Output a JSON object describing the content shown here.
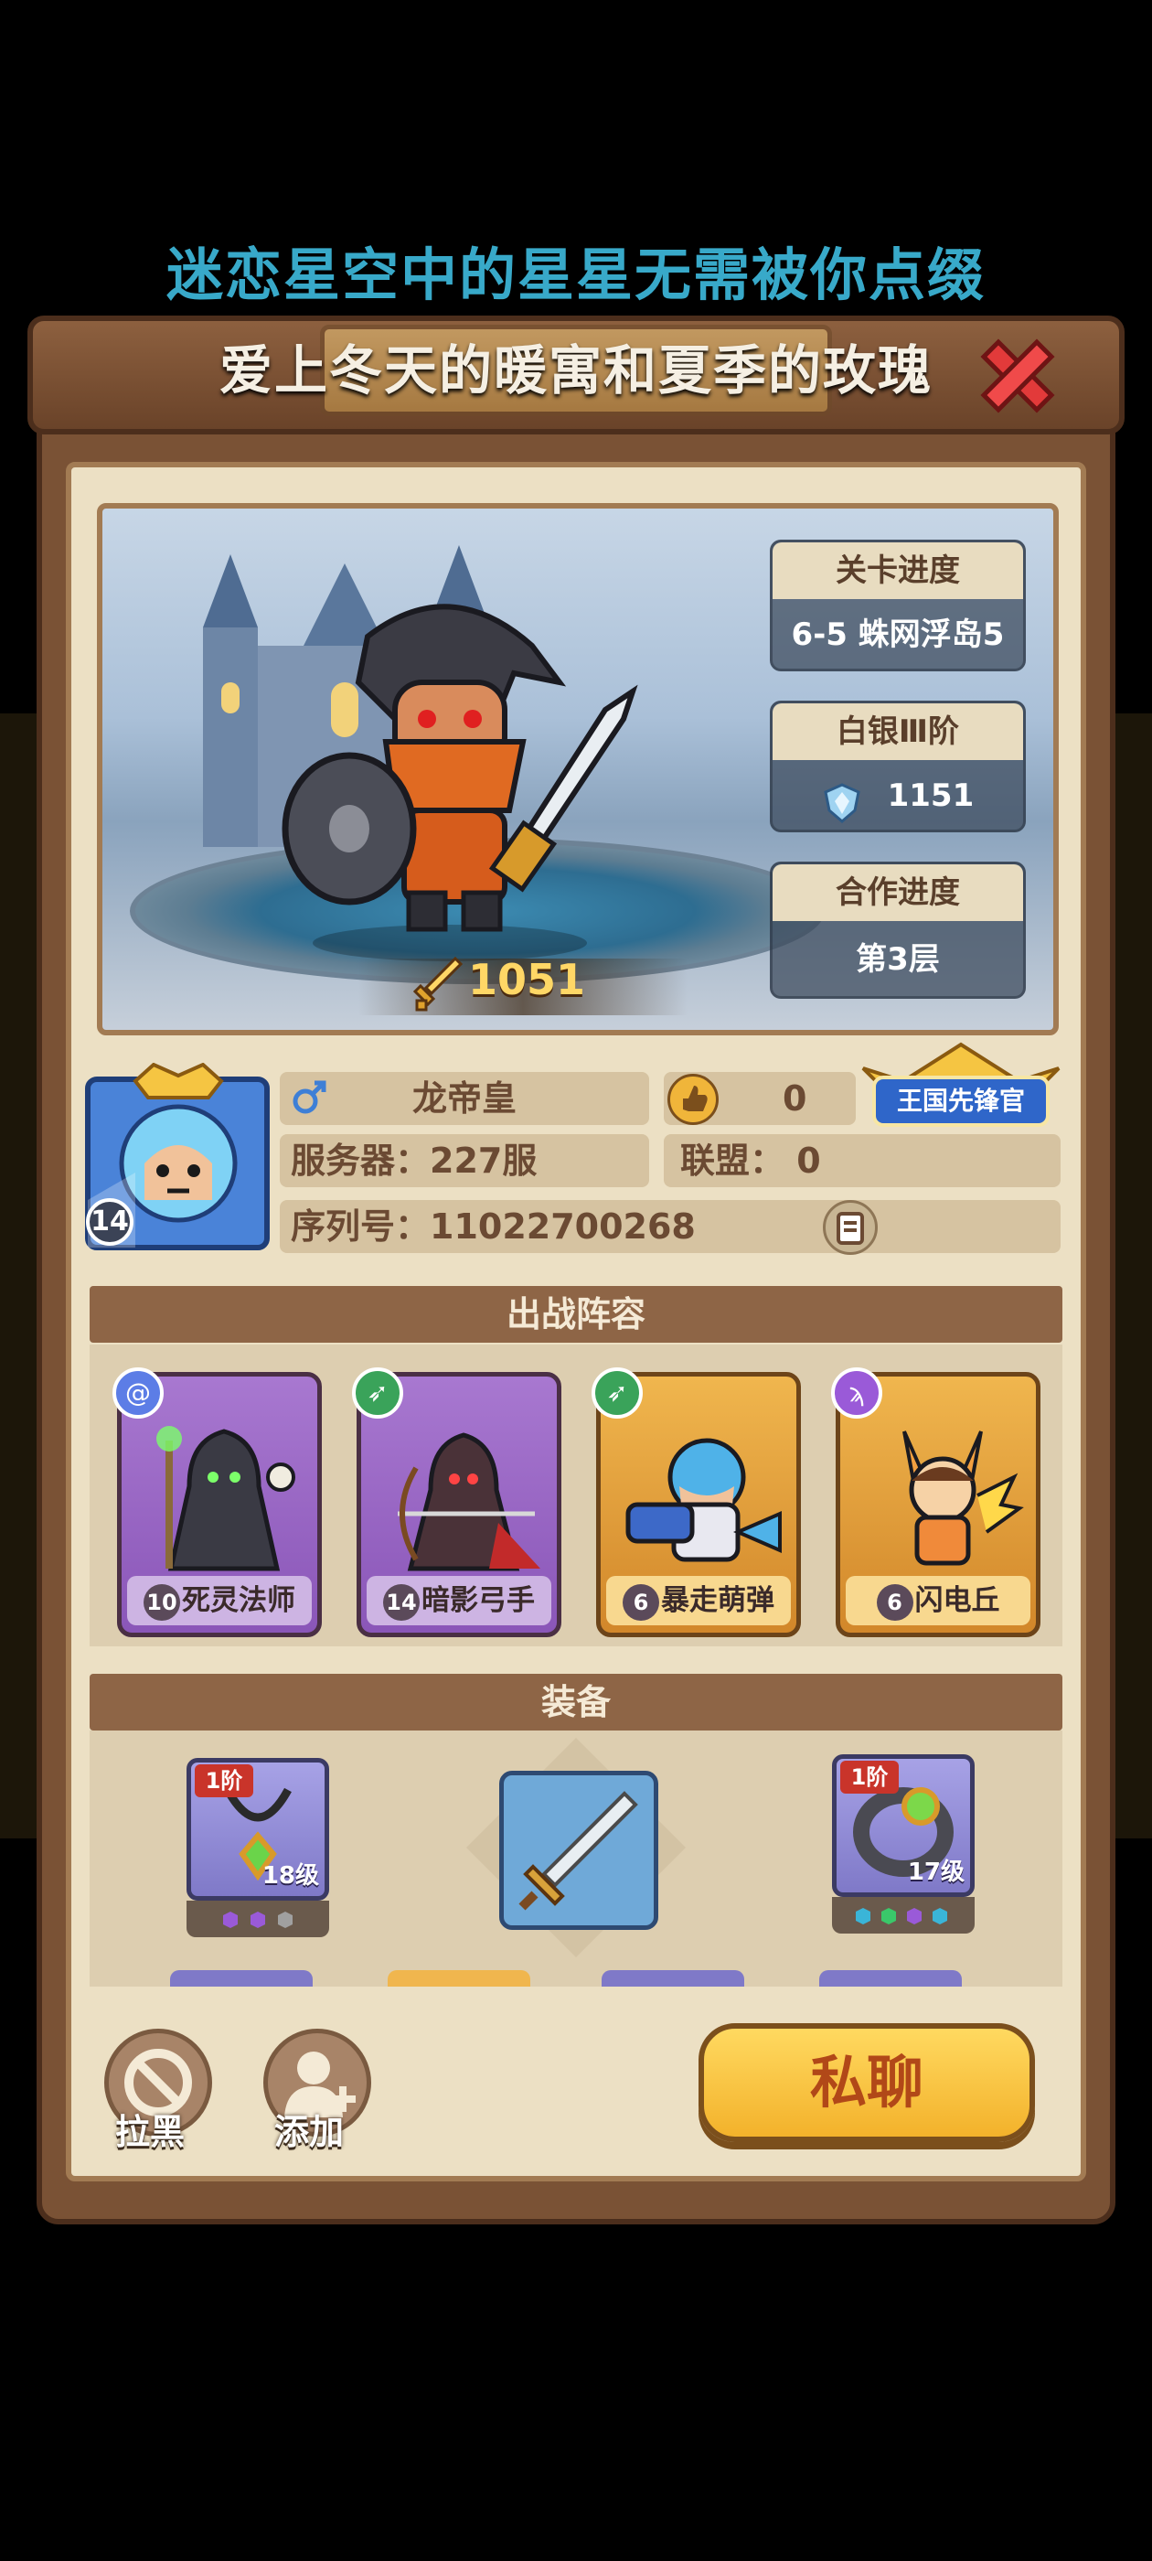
{
  "overlay": {
    "line1": "迷恋星空中的星星无需被你点缀",
    "line2": "爱上冬天的暖寓和夏季的玫瑰"
  },
  "stats": [
    {
      "title": "关卡进度",
      "value": "6-5 蛛网浮岛5"
    },
    {
      "title": "白银Ⅲ阶",
      "value": "1151",
      "icon": "rank-shield-icon"
    },
    {
      "title": "合作进度",
      "value": "第3层"
    }
  ],
  "hero": {
    "power": "1051"
  },
  "profile": {
    "avatar_level": "14",
    "gender_icon": "male-icon",
    "name": "龙帝皇",
    "likes": "0",
    "server": "服务器：227服",
    "alliance": "联盟：  0",
    "serial": "序列号：11022700268",
    "badge": "王国先锋官"
  },
  "lineup": {
    "title": "出战阵容",
    "cards": [
      {
        "level": "10",
        "name": "死灵法师",
        "rarity": "purple",
        "class_icon": "spiral-icon"
      },
      {
        "level": "14",
        "name": "暗影弓手",
        "rarity": "purple",
        "class_icon": "bow-icon"
      },
      {
        "level": "6",
        "name": "暴走萌弹",
        "rarity": "gold",
        "class_icon": "bow-icon"
      },
      {
        "level": "6",
        "name": "闪电丘",
        "rarity": "gold",
        "class_icon": "wand-icon"
      }
    ]
  },
  "equipment": {
    "title": "装备",
    "items": [
      {
        "rank": "1阶",
        "level": "18级",
        "icon": "necklace-icon"
      },
      {
        "rank": "",
        "level": "",
        "icon": "sword-icon"
      },
      {
        "rank": "1阶",
        "level": "17级",
        "icon": "ring-icon"
      }
    ]
  },
  "actions": {
    "block": "拉黑",
    "add": "添加",
    "chat": "私聊"
  },
  "colors": {
    "frame": "#7a5235",
    "paper": "#ece0c4",
    "header": "#8e6546",
    "chat_button": "#f3b22b"
  }
}
